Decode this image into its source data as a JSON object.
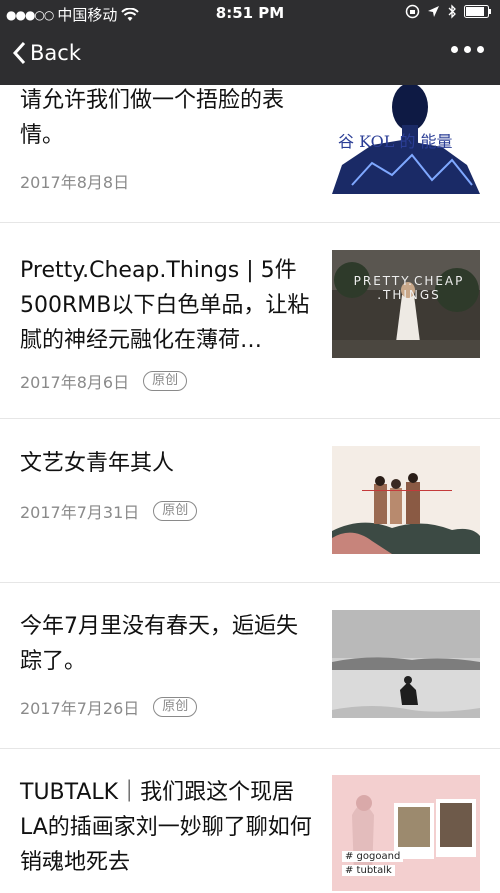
{
  "status_bar": {
    "carrier": "中国移动",
    "time": "8:51 PM"
  },
  "nav": {
    "back_label": "Back"
  },
  "articles": [
    {
      "title": "请允许我们做一个捂脸的表情。",
      "date": "2017年8月8日",
      "badge": ""
    },
    {
      "title": "Pretty.Cheap.Things | 5件500RMB以下白色单品，让粘腻的神经元融化在薄荷…",
      "date": "2017年8月6日",
      "badge": "原创"
    },
    {
      "title": "文艺女青年其人",
      "date": "2017年7月31日",
      "badge": "原创"
    },
    {
      "title": "今年7月里没有春天，逅逅失踪了。",
      "date": "2017年7月26日",
      "badge": "原创"
    },
    {
      "title": "TUBTALK｜我们跟这个现居LA的插画家刘一妙聊了聊如何销魂地死去",
      "date": "",
      "badge": ""
    }
  ],
  "thumbs": {
    "item2_text": "PRETTY.CHEAP .THINGS",
    "item5_tag1": "# gogoand",
    "item5_tag2": "# tubtalk"
  }
}
